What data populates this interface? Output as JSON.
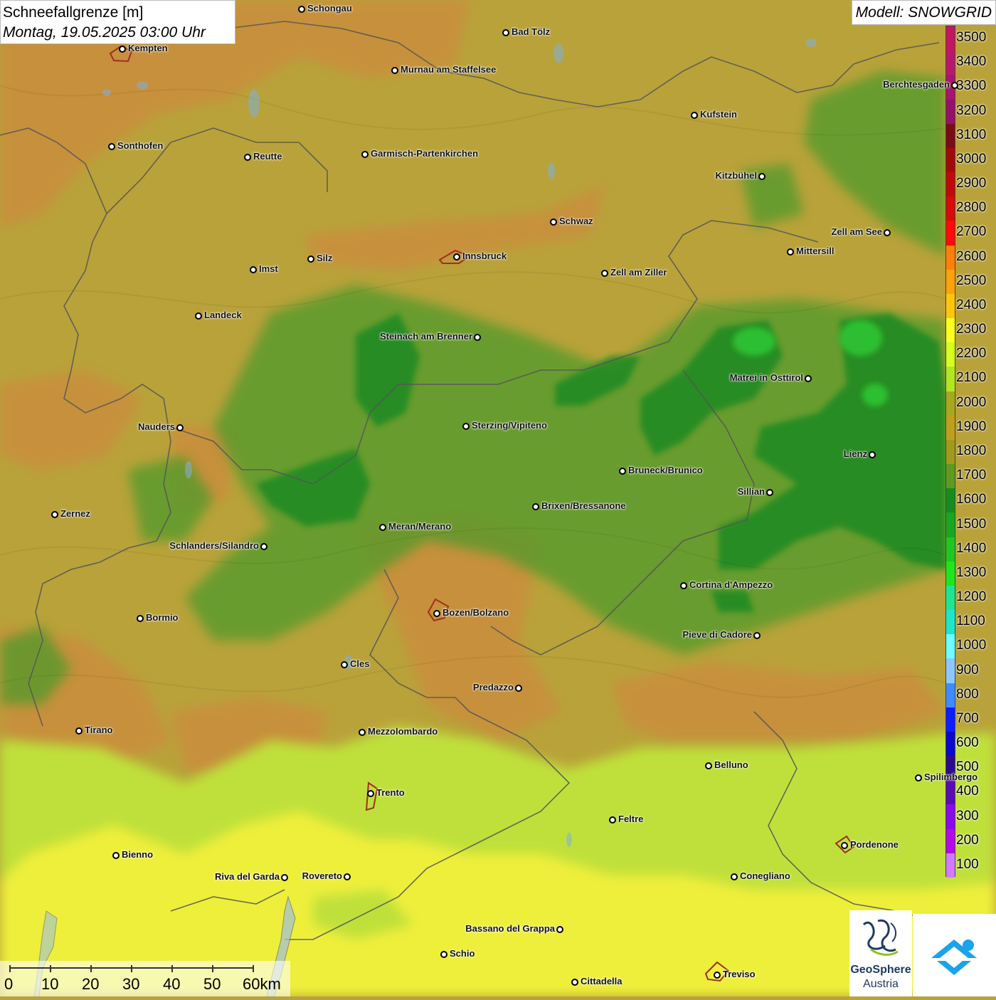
{
  "title": {
    "parameter": "Schneefallgrenze",
    "unit": "[m]",
    "datetime": "Montag, 19.05.2025 03:00 Uhr"
  },
  "model": "Modell: SNOWGRID",
  "legend": {
    "labels": [
      "3500",
      "3400",
      "3300",
      "3200",
      "3100",
      "3000",
      "2900",
      "2800",
      "2700",
      "2600",
      "2500",
      "2400",
      "2300",
      "2200",
      "2100",
      "2000",
      "1900",
      "1800",
      "1700",
      "1600",
      "1500",
      "1400",
      "1300",
      "1200",
      "1100",
      "1000",
      "900",
      "800",
      "700",
      "600",
      "500",
      "400",
      "300",
      "200",
      "100"
    ],
    "colors": [
      "#c4165e",
      "#b8186c",
      "#a8156c",
      "#951068",
      "#7a0b16",
      "#a20a0a",
      "#bf0a0a",
      "#d80a0a",
      "#ff0a0a",
      "#ff7f0a",
      "#ffa20a",
      "#ffc60a",
      "#ffff1e",
      "#d6ff1e",
      "#b2e61e",
      "#a8a81e",
      "#bfa01e",
      "#a09a1e",
      "#5e9a1e",
      "#168c1e",
      "#16a81e",
      "#1ec81e",
      "#1ee61e",
      "#1ee68e",
      "#1ee6c8",
      "#6effff",
      "#8cc8ff",
      "#3c8cff",
      "#0a1eff",
      "#0a0ac8",
      "#2c0a8c",
      "#5c0ab4",
      "#8c0ae6",
      "#b40ae6",
      "#d27aff"
    ]
  },
  "cities": [
    {
      "name": "Schongau",
      "side": "right"
    },
    {
      "name": "Bad Tölz",
      "side": "right"
    },
    {
      "name": "Kempten",
      "side": "right"
    },
    {
      "name": "Murnau am Staffelsee",
      "side": "right"
    },
    {
      "name": "Berchtesgaden",
      "side": "left"
    },
    {
      "name": "Kufstein",
      "side": "right"
    },
    {
      "name": "Sonthofen",
      "side": "right"
    },
    {
      "name": "Reutte",
      "side": "right"
    },
    {
      "name": "Garmisch-Partenkirchen",
      "side": "right"
    },
    {
      "name": "Kitzbühel",
      "side": "left"
    },
    {
      "name": "Schwaz",
      "side": "right"
    },
    {
      "name": "Zell am See",
      "side": "left"
    },
    {
      "name": "Mittersill",
      "side": "right"
    },
    {
      "name": "Innsbruck",
      "side": "right"
    },
    {
      "name": "Imst",
      "side": "right"
    },
    {
      "name": "Silz",
      "side": "right"
    },
    {
      "name": "Zell am Ziller",
      "side": "right"
    },
    {
      "name": "Landeck",
      "side": "right"
    },
    {
      "name": "Steinach am Brenner",
      "side": "left"
    },
    {
      "name": "Matrei in Osttirol",
      "side": "left"
    },
    {
      "name": "Nauders",
      "side": "left"
    },
    {
      "name": "Sterzing/Vipiteno",
      "side": "right"
    },
    {
      "name": "Lienz",
      "side": "left"
    },
    {
      "name": "Bruneck/Brunico",
      "side": "right"
    },
    {
      "name": "Sillian",
      "side": "left"
    },
    {
      "name": "Zernez",
      "side": "right"
    },
    {
      "name": "Brixen/Bressanone",
      "side": "right"
    },
    {
      "name": "Meran/Merano",
      "side": "right"
    },
    {
      "name": "Schlanders/Silandro",
      "side": "left"
    },
    {
      "name": "Cortina d'Ampezzo",
      "side": "right"
    },
    {
      "name": "Bozen/Bolzano",
      "side": "right"
    },
    {
      "name": "Bormio",
      "side": "right"
    },
    {
      "name": "Pieve di Cadore",
      "side": "left"
    },
    {
      "name": "Cles",
      "side": "right"
    },
    {
      "name": "Predazzo",
      "side": "left"
    },
    {
      "name": "Tirano",
      "side": "right"
    },
    {
      "name": "Mezzolombardo",
      "side": "right"
    },
    {
      "name": "Belluno",
      "side": "right"
    },
    {
      "name": "Spilimbergo",
      "side": "right"
    },
    {
      "name": "Trento",
      "side": "right"
    },
    {
      "name": "Feltre",
      "side": "right"
    },
    {
      "name": "Pordenone",
      "side": "right"
    },
    {
      "name": "Bienno",
      "side": "right"
    },
    {
      "name": "Riva del Garda",
      "side": "left"
    },
    {
      "name": "Rovereto",
      "side": "left"
    },
    {
      "name": "Conegliano",
      "side": "right"
    },
    {
      "name": "Bassano del Grappa",
      "side": "left"
    },
    {
      "name": "Schio",
      "side": "right"
    },
    {
      "name": "Treviso",
      "side": "right"
    },
    {
      "name": "Cittadella",
      "side": "right"
    }
  ],
  "scale_bar": {
    "labels": [
      "0",
      "10",
      "20",
      "30",
      "40",
      "50",
      "60km"
    ]
  },
  "logos": {
    "geosphere_line1": "GeoSphere",
    "geosphere_line2": "Austria"
  },
  "colors": {
    "base": "#b9a23a",
    "orange_zone": "#c98f3e",
    "green_zone": "#4f9a2c",
    "deep_green": "#1f8a24",
    "lime_zone": "#c6e43a",
    "yellow_zone": "#f2f23a",
    "border_line": "#555555"
  }
}
